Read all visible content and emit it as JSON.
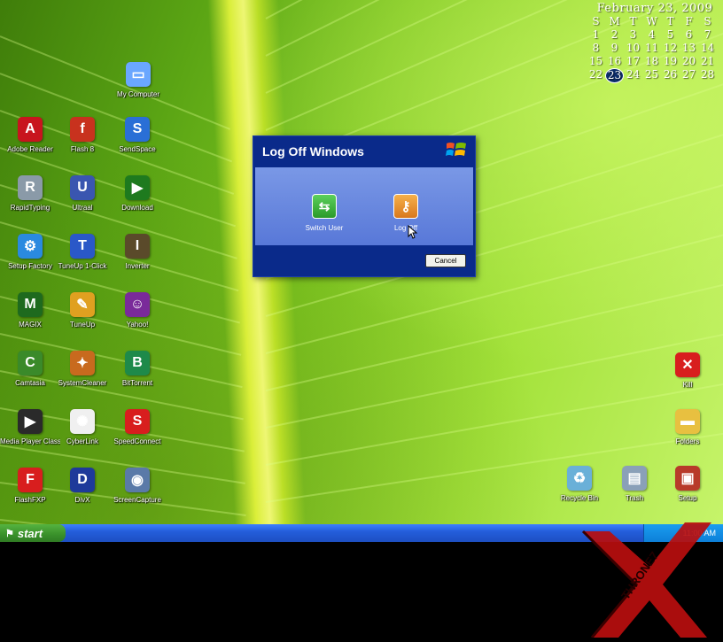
{
  "desktop": {
    "left_icons": [
      {
        "label": "My Computer",
        "icon": "my-computer-icon",
        "color": "#6aa7ff",
        "glyph": "▭"
      },
      {
        "label": "Adobe Reader",
        "icon": "adobe-reader-icon",
        "color": "#c8141e",
        "glyph": "A"
      },
      {
        "label": "Flash 8",
        "icon": "flash-icon",
        "color": "#c8321e",
        "glyph": "f"
      },
      {
        "label": "SendSpace",
        "icon": "sendspace-icon",
        "color": "#2a6fd6",
        "glyph": "S"
      },
      {
        "label": "RapidTyping",
        "icon": "rapidtyping-icon",
        "color": "#8a9aa8",
        "glyph": "R"
      },
      {
        "label": "Ultraal",
        "icon": "ultraiso-icon",
        "color": "#3a56b0",
        "glyph": "U"
      },
      {
        "label": "Download",
        "icon": "download-icon",
        "color": "#1e7a1e",
        "glyph": "▶"
      },
      {
        "label": "Setup Factory",
        "icon": "setup-factory-icon",
        "color": "#2a8ae0",
        "glyph": "⚙"
      },
      {
        "label": "TuneUp 1-Click",
        "icon": "tuneup-one-click-icon",
        "color": "#2a58c8",
        "glyph": "T"
      },
      {
        "label": "Inverter",
        "icon": "inverter-icon",
        "color": "#5a4a2a",
        "glyph": "I"
      },
      {
        "label": "MAGIX",
        "icon": "magix-icon",
        "color": "#1e6a1e",
        "glyph": "M"
      },
      {
        "label": "TuneUp",
        "icon": "tuneup-icon",
        "color": "#e0a020",
        "glyph": "✎"
      },
      {
        "label": "Yahoo!",
        "icon": "yahoo-messenger-icon",
        "color": "#7a2a9a",
        "glyph": "☺"
      },
      {
        "label": "Camtasia",
        "icon": "camtasia-icon",
        "color": "#3a8a2a",
        "glyph": "C"
      },
      {
        "label": "SystemCleaner",
        "icon": "system-cleaner-icon",
        "color": "#c86a1e",
        "glyph": "✦"
      },
      {
        "label": "BitTorrent",
        "icon": "bittorrent-icon",
        "color": "#1e8a4a",
        "glyph": "B"
      },
      {
        "label": "Media Player Classic",
        "icon": "media-player-classic-icon",
        "color": "#2a2a2a",
        "glyph": "▶"
      },
      {
        "label": "CyberLink",
        "icon": "cyberlink-icon",
        "color": "#f0f0f0",
        "glyph": "✺"
      },
      {
        "label": "SpeedConnect",
        "icon": "speedconnect-icon",
        "color": "#d81e1e",
        "glyph": "S"
      },
      {
        "label": "FlashFXP",
        "icon": "flashfxp-icon",
        "color": "#d81e1e",
        "glyph": "F"
      },
      {
        "label": "DivX",
        "icon": "divx-icon",
        "color": "#1e3a9a",
        "glyph": "D"
      },
      {
        "label": "ScreenCapture",
        "icon": "screen-capture-icon",
        "color": "#5a7aa8",
        "glyph": "◉"
      }
    ],
    "right_icons": [
      {
        "label": "Kill",
        "icon": "red-x-icon",
        "color": "#d81e1e",
        "glyph": "✕"
      },
      {
        "label": "Folders",
        "icon": "folder-icon",
        "color": "#e8c040",
        "glyph": "▬"
      },
      {
        "label": "Recycle Bin",
        "icon": "recycle-bin-icon",
        "color": "#6ab0d8",
        "glyph": "♻"
      },
      {
        "label": "Trash",
        "icon": "trash-icon",
        "color": "#8aa0b8",
        "glyph": "▤"
      },
      {
        "label": "Setup",
        "icon": "setup-icon",
        "color": "#b83a2a",
        "glyph": "▣"
      }
    ]
  },
  "calendar": {
    "title": "February 23, 2009",
    "weekdays": [
      "S",
      "M",
      "T",
      "W",
      "T",
      "F",
      "S"
    ],
    "days": [
      "1",
      "2",
      "3",
      "4",
      "5",
      "6",
      "7",
      "8",
      "9",
      "10",
      "11",
      "12",
      "13",
      "14",
      "15",
      "16",
      "17",
      "18",
      "19",
      "20",
      "21",
      "22",
      "23",
      "24",
      "25",
      "26",
      "27",
      "28"
    ],
    "today": "23"
  },
  "dialog": {
    "title": "Log Off Windows",
    "switch_user_label": "Switch User",
    "log_off_label": "Log Off",
    "cancel_label": "Cancel"
  },
  "taskbar": {
    "start_label": "start",
    "clock": "11:00 AM"
  },
  "watermark": {
    "text": "THRONE7"
  },
  "colors": {
    "dialog_frame": "#0a2a8a",
    "taskbar": "#245edb",
    "start_button": "#39902a"
  }
}
